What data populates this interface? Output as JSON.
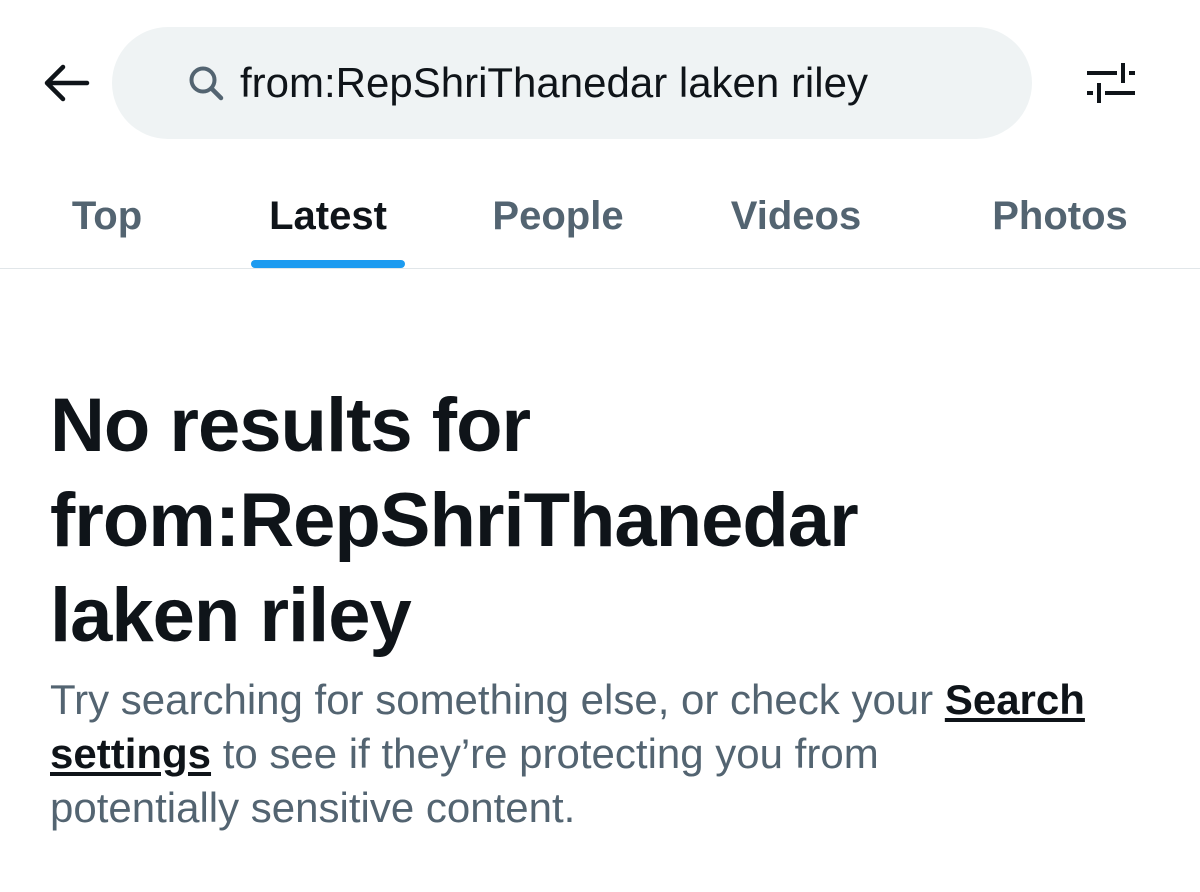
{
  "header": {
    "back_icon": "arrow-left-icon",
    "search": {
      "icon": "search-icon",
      "value": "from:RepShriThanedar laken riley"
    },
    "filter_icon": "sliders-icon"
  },
  "tabs": [
    {
      "label": "Top",
      "active": false
    },
    {
      "label": "Latest",
      "active": true
    },
    {
      "label": "People",
      "active": false
    },
    {
      "label": "Videos",
      "active": false
    },
    {
      "label": "Photos",
      "active": false
    }
  ],
  "empty_state": {
    "title_line1": "No results for",
    "title_line2": "from:RepShriThanedar",
    "title_line3": "laken riley",
    "body_part1": "Try searching for something else, or check your ",
    "body_link_line1": "Search",
    "body_link_line2": "settings",
    "body_part2": " to see if they’re protecting you from",
    "body_part3": "potentially sensitive content."
  },
  "colors": {
    "accent": "#1d9bf0",
    "text_primary": "#0f1419",
    "text_secondary": "#536471",
    "search_bg": "#eff3f4",
    "divider": "#e1e6e9"
  }
}
